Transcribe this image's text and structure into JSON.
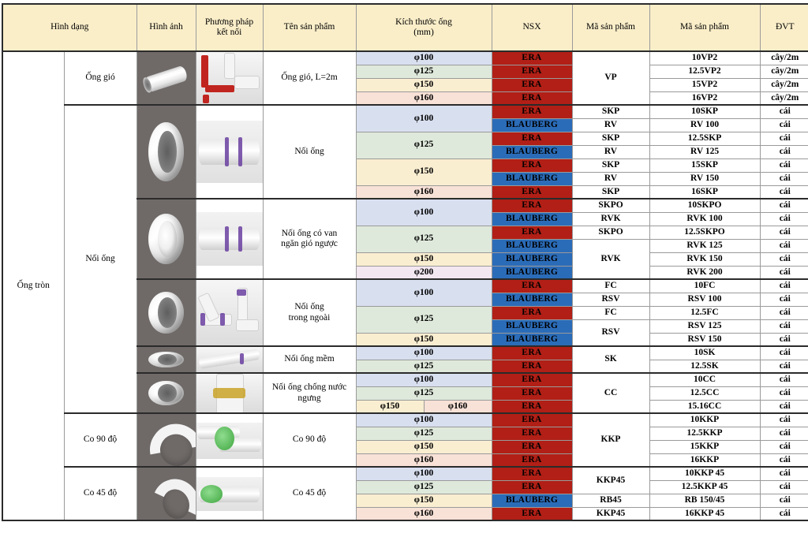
{
  "table": {
    "headers": [
      {
        "label": "Hình dạng",
        "colspan": 2
      },
      {
        "label": "Hình ảnh",
        "colspan": 1
      },
      {
        "label": "Phương pháp\nkết nối",
        "line1": "Phương pháp",
        "line2": "kết nối",
        "colspan": 1
      },
      {
        "label": "Tên sản phẩm",
        "colspan": 1
      },
      {
        "label": "Kích thước ống\n(mm)",
        "line1": "Kích thước ống",
        "line2": "(mm)",
        "colspan": 2
      },
      {
        "label": "NSX",
        "colspan": 1
      },
      {
        "label": "Mã sản phẩm",
        "colspan": 1
      },
      {
        "label": "Mã sản phẩm",
        "colspan": 1
      },
      {
        "label": "ĐVT",
        "colspan": 1
      }
    ],
    "shape_label": "Ống tròn",
    "groups": [
      {
        "kind": "Ống gió",
        "image_icon": "round-duct-pipe-icon",
        "conn_icon": "duct-red-connection-icon",
        "product_name": "Ống gió,  L=2m",
        "rows": [
          {
            "size": "φ100",
            "size_class": "c100",
            "brand": "ERA",
            "code1": "VP",
            "code1_rowspan": 4,
            "code2": "10VP2",
            "unit": "cây/2m"
          },
          {
            "size": "φ125",
            "size_class": "c125",
            "brand": "ERA",
            "code2": "12.5VP2",
            "unit": "cây/2m"
          },
          {
            "size": "φ150",
            "size_class": "c150",
            "brand": "ERA",
            "code2": "15VP2",
            "unit": "cây/2m"
          },
          {
            "size": "φ160",
            "size_class": "c160",
            "brand": "ERA",
            "code2": "16VP2",
            "unit": "cây/2m"
          }
        ]
      },
      {
        "kind": "Nối ống",
        "image_icon": "pipe-connector-ring-icon",
        "conn_icon": "pipe-joint-purple-band-icon",
        "product_name": "Nối ống",
        "rows": [
          {
            "size": "φ100",
            "size_class": "c100",
            "size_rowspan": 2,
            "brand": "ERA",
            "code1": "SKP",
            "code2": "10SKP",
            "unit": "cái"
          },
          {
            "brand": "BLAUBERG",
            "code1": "RV",
            "code2": "RV 100",
            "unit": "cái"
          },
          {
            "size": "φ125",
            "size_class": "c125",
            "size_rowspan": 2,
            "brand": "ERA",
            "code1": "SKP",
            "code2": "12.5SKP",
            "unit": "cái"
          },
          {
            "brand": "BLAUBERG",
            "code1": "RV",
            "code2": "RV 125",
            "unit": "cái"
          },
          {
            "size": "φ150",
            "size_class": "c150",
            "size_rowspan": 2,
            "brand": "ERA",
            "code1": "SKP",
            "code2": "15SKP",
            "unit": "cái"
          },
          {
            "brand": "BLAUBERG",
            "code1": "RV",
            "code2": "RV 150",
            "unit": "cái"
          },
          {
            "size": "φ160",
            "size_class": "c160",
            "brand": "ERA",
            "code1": "SKP",
            "code2": "16SKP",
            "unit": "cái"
          }
        ]
      },
      {
        "kind": null,
        "image_icon": "backdraft-damper-ring-icon",
        "conn_icon": "pipe-joint-purple-band-icon",
        "product_name": "Nối ống có van ngăn gió ngược",
        "product_name_l1": "Nối ống có van",
        "product_name_l2": "ngăn gió ngược",
        "rows": [
          {
            "size": "φ100",
            "size_class": "c100",
            "size_rowspan": 2,
            "brand": "ERA",
            "code1": "SKPO",
            "code2": "10SKPO",
            "unit": "cái"
          },
          {
            "brand": "BLAUBERG",
            "code1": "RVK",
            "code2": "RVK 100",
            "unit": "cái"
          },
          {
            "size": "φ125",
            "size_class": "c125",
            "size_rowspan": 2,
            "brand": "ERA",
            "code1": "SKPO",
            "code2": "12.5SKPO",
            "unit": "cái"
          },
          {
            "brand": "BLAUBERG",
            "code1": "RVK",
            "code1_rowspan": 3,
            "code2": "RVK 125",
            "unit": "cái"
          },
          {
            "size": "φ150",
            "size_class": "c150",
            "brand": "BLAUBERG",
            "code2": "RVK 150",
            "unit": "cái"
          },
          {
            "size": "φ200",
            "size_class": "c200",
            "brand": "BLAUBERG",
            "code2": "RVK 200",
            "unit": "cái"
          }
        ]
      },
      {
        "kind": null,
        "image_icon": "coupling-sleeve-icon",
        "conn_icon": "pipe-network-purple-icon",
        "product_name": "Nối ống trong ngoài",
        "product_name_l1": "Nối ống",
        "product_name_l2": "trong ngoài",
        "rows": [
          {
            "size": "φ100",
            "size_class": "c100",
            "size_rowspan": 2,
            "brand": "ERA",
            "code1": "FC",
            "code2": "10FC",
            "unit": "cái"
          },
          {
            "brand": "BLAUBERG",
            "code1": "RSV",
            "code2": "RSV 100",
            "unit": "cái"
          },
          {
            "size": "φ125",
            "size_class": "c125",
            "size_rowspan": 2,
            "brand": "ERA",
            "code1": "FC",
            "code2": "12.5FC",
            "unit": "cái"
          },
          {
            "brand": "BLAUBERG",
            "code1": "RSV",
            "code1_rowspan": 2,
            "code2": "RSV 125",
            "unit": "cái"
          },
          {
            "size": "φ150",
            "size_class": "c150",
            "brand": "BLAUBERG",
            "code2": "RSV 150",
            "unit": "cái"
          }
        ]
      },
      {
        "kind": null,
        "image_icon": "flexible-pipe-connector-icon",
        "conn_icon": "flexible-pipe-joint-icon",
        "product_name": "Nối ống mềm",
        "rows": [
          {
            "size": "φ100",
            "size_class": "c100",
            "brand": "ERA",
            "code1": "SK",
            "code1_rowspan": 2,
            "code2": "10SK",
            "unit": "cái"
          },
          {
            "size": "φ125",
            "size_class": "c125",
            "brand": "ERA",
            "code2": "12.5SK",
            "unit": "cái"
          }
        ]
      },
      {
        "kind": null,
        "image_icon": "condensation-proof-connector-icon",
        "conn_icon": "gold-ring-pipe-icon",
        "product_name": "Nối ống chống nước ngưng",
        "product_name_l1": "Nối ống chống nước",
        "product_name_l2": "ngưng",
        "rows": [
          {
            "size": "φ100",
            "size_class": "c100",
            "brand": "ERA",
            "code1": "CC",
            "code1_rowspan": 3,
            "code2": "10CC",
            "unit": "cái"
          },
          {
            "size": "φ125",
            "size_class": "c125",
            "brand": "ERA",
            "code2": "12.5CC",
            "unit": "cái"
          },
          {
            "size": "φ150",
            "size_class": "c150",
            "size_b": "φ160",
            "size_b_class": "c160",
            "split": true,
            "brand": "ERA",
            "code2": "15.16CC",
            "unit": "cái"
          }
        ]
      },
      {
        "kind": "Co 90 độ",
        "image_icon": "elbow-90-icon",
        "conn_icon": "elbow-90-green-joint-icon",
        "product_name": "Co 90 độ",
        "rows": [
          {
            "size": "φ100",
            "size_class": "c100",
            "brand": "ERA",
            "code1": "KKP",
            "code1_rowspan": 4,
            "code2": "10KKP",
            "unit": "cái"
          },
          {
            "size": "φ125",
            "size_class": "c125",
            "brand": "ERA",
            "code2": "12.5KKP",
            "unit": "cái"
          },
          {
            "size": "φ150",
            "size_class": "c150",
            "brand": "ERA",
            "code2": "15KKP",
            "unit": "cái"
          },
          {
            "size": "φ160",
            "size_class": "c160",
            "brand": "ERA",
            "code2": "16KKP",
            "unit": "cái"
          }
        ]
      },
      {
        "kind": "Co 45 độ",
        "image_icon": "elbow-45-icon",
        "conn_icon": "elbow-45-green-joint-icon",
        "product_name": "Co 45 độ",
        "rows": [
          {
            "size": "φ100",
            "size_class": "c100",
            "brand": "ERA",
            "code1": "KKP45",
            "code1_rowspan": 2,
            "code2": "10KKP 45",
            "unit": "cái"
          },
          {
            "size": "φ125",
            "size_class": "c125",
            "brand": "ERA",
            "code2": "12.5KKP 45",
            "unit": "cái"
          },
          {
            "size": "φ150",
            "size_class": "c150",
            "brand": "BLAUBERG",
            "code1": "RB45",
            "code2": "RB 150/45",
            "unit": "cái"
          },
          {
            "size": "φ160",
            "size_class": "c160",
            "brand": "ERA",
            "code1": "KKP45",
            "code2": "16KKP 45",
            "unit": "cái"
          }
        ]
      }
    ]
  },
  "colors": {
    "header_bg": "#faeec9",
    "era_red": "#b11f16",
    "blauberg_blue": "#2b6cb8",
    "size_100": "#d8dfef",
    "size_125": "#dfe9db",
    "size_150": "#faeed1",
    "size_160": "#f8e1d6",
    "size_200": "#f3e7f1",
    "image_bg": "#6f6a68",
    "border": "#2b2b2b"
  }
}
